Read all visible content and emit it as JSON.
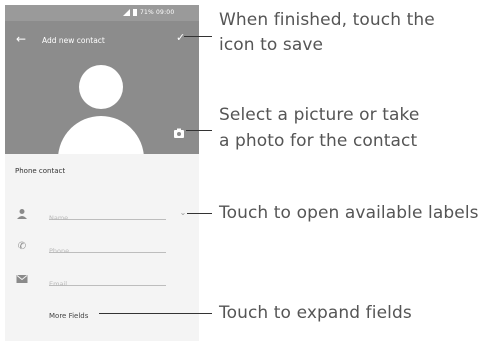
{
  "status_bar": {
    "text": "71% 09:00"
  },
  "app_bar": {
    "back_icon": "arrow-left-icon",
    "title": "Add new contact",
    "save_icon": "checkmark-icon"
  },
  "photo": {
    "camera_icon": "camera-icon"
  },
  "section_title": "Phone contact",
  "fields": {
    "name": {
      "placeholder": "Name",
      "icon": "person-icon"
    },
    "phone": {
      "placeholder": "Phone",
      "icon": "phone-icon"
    },
    "email": {
      "placeholder": "Email",
      "icon": "mail-icon"
    }
  },
  "labels_icon": "chevron-down-icon",
  "more_fields": "More Fields",
  "callouts": {
    "save_line1": "When finished, touch the",
    "save_line2": "icon to save",
    "photo_line1": "Select a picture or take",
    "photo_line2": "a photo for the contact",
    "labels": "Touch to open available labels",
    "expand": "Touch to expand fields"
  }
}
